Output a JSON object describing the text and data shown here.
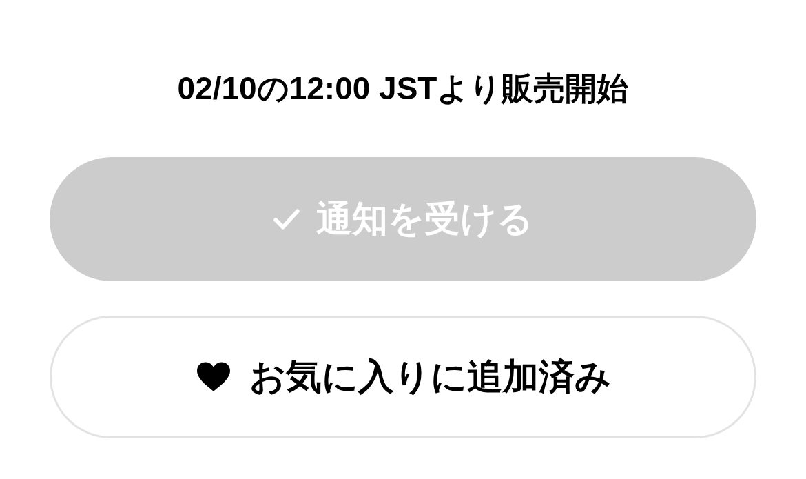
{
  "sale_notice": "02/10の12:00 JSTより販売開始",
  "notify_button": {
    "label": "通知を受ける",
    "disabled": true
  },
  "favorite_button": {
    "label": "お気に入りに追加済み",
    "favorited": true
  }
}
